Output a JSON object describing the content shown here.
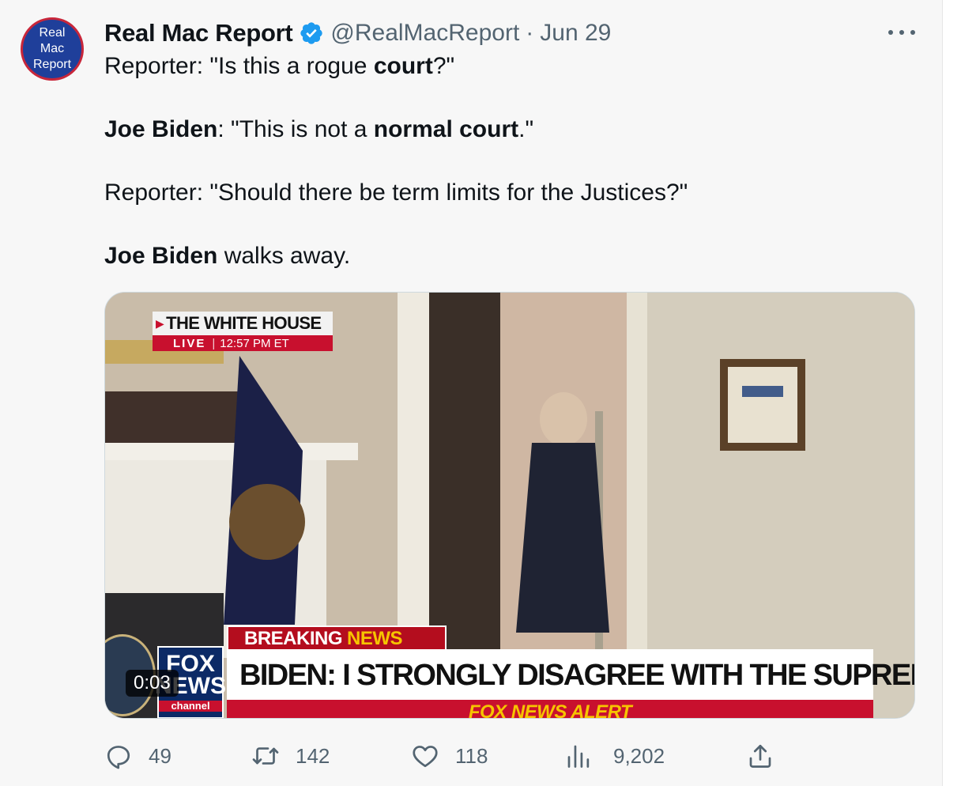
{
  "tweet": {
    "avatar_lines": [
      "Real",
      "Mac",
      "Report"
    ],
    "display_name": "Real Mac Report",
    "handle": "@RealMacReport",
    "separator": "·",
    "date": "Jun 29",
    "lines": [
      {
        "runs": [
          {
            "t": "Reporter: \"Is this a rogue "
          },
          {
            "t": "court",
            "b": true
          },
          {
            "t": "?\""
          }
        ]
      },
      {
        "runs": [
          {
            "t": "Joe Biden",
            "b": true
          },
          {
            "t": ": \"This is not a "
          },
          {
            "t": "normal court",
            "b": true
          },
          {
            "t": ".\""
          }
        ]
      },
      {
        "runs": [
          {
            "t": "Reporter: \"Should there be term limits for the Justices?\""
          }
        ]
      },
      {
        "runs": [
          {
            "t": "Joe Biden",
            "b": true
          },
          {
            "t": " walks away."
          }
        ]
      }
    ]
  },
  "video": {
    "wh_title": "THE WHITE HOUSE",
    "live_label": "LIVE",
    "live_sep": "|",
    "live_time": "12:57 PM ET",
    "breaking_label": "BREAKING",
    "breaking_news": "NEWS",
    "headline": "BIDEN: I STRONGLY DISAGREE WITH THE SUPREME COURT",
    "alert": "FOX NEWS ALERT",
    "logo_top": "FOX",
    "logo_bottom": "NEWS",
    "logo_channel": "channel",
    "timestamp": "0:03"
  },
  "actions": {
    "replies": "49",
    "retweets": "142",
    "likes": "118",
    "views": "9,202"
  },
  "colors": {
    "verified": "#1d9bf0",
    "secondary_text": "#536471",
    "fox_red": "#c8102e",
    "fox_blue": "#0c2a66"
  },
  "icons": [
    "verified-badge-icon",
    "more-icon",
    "reply-icon",
    "retweet-icon",
    "like-icon",
    "views-icon",
    "share-icon"
  ]
}
